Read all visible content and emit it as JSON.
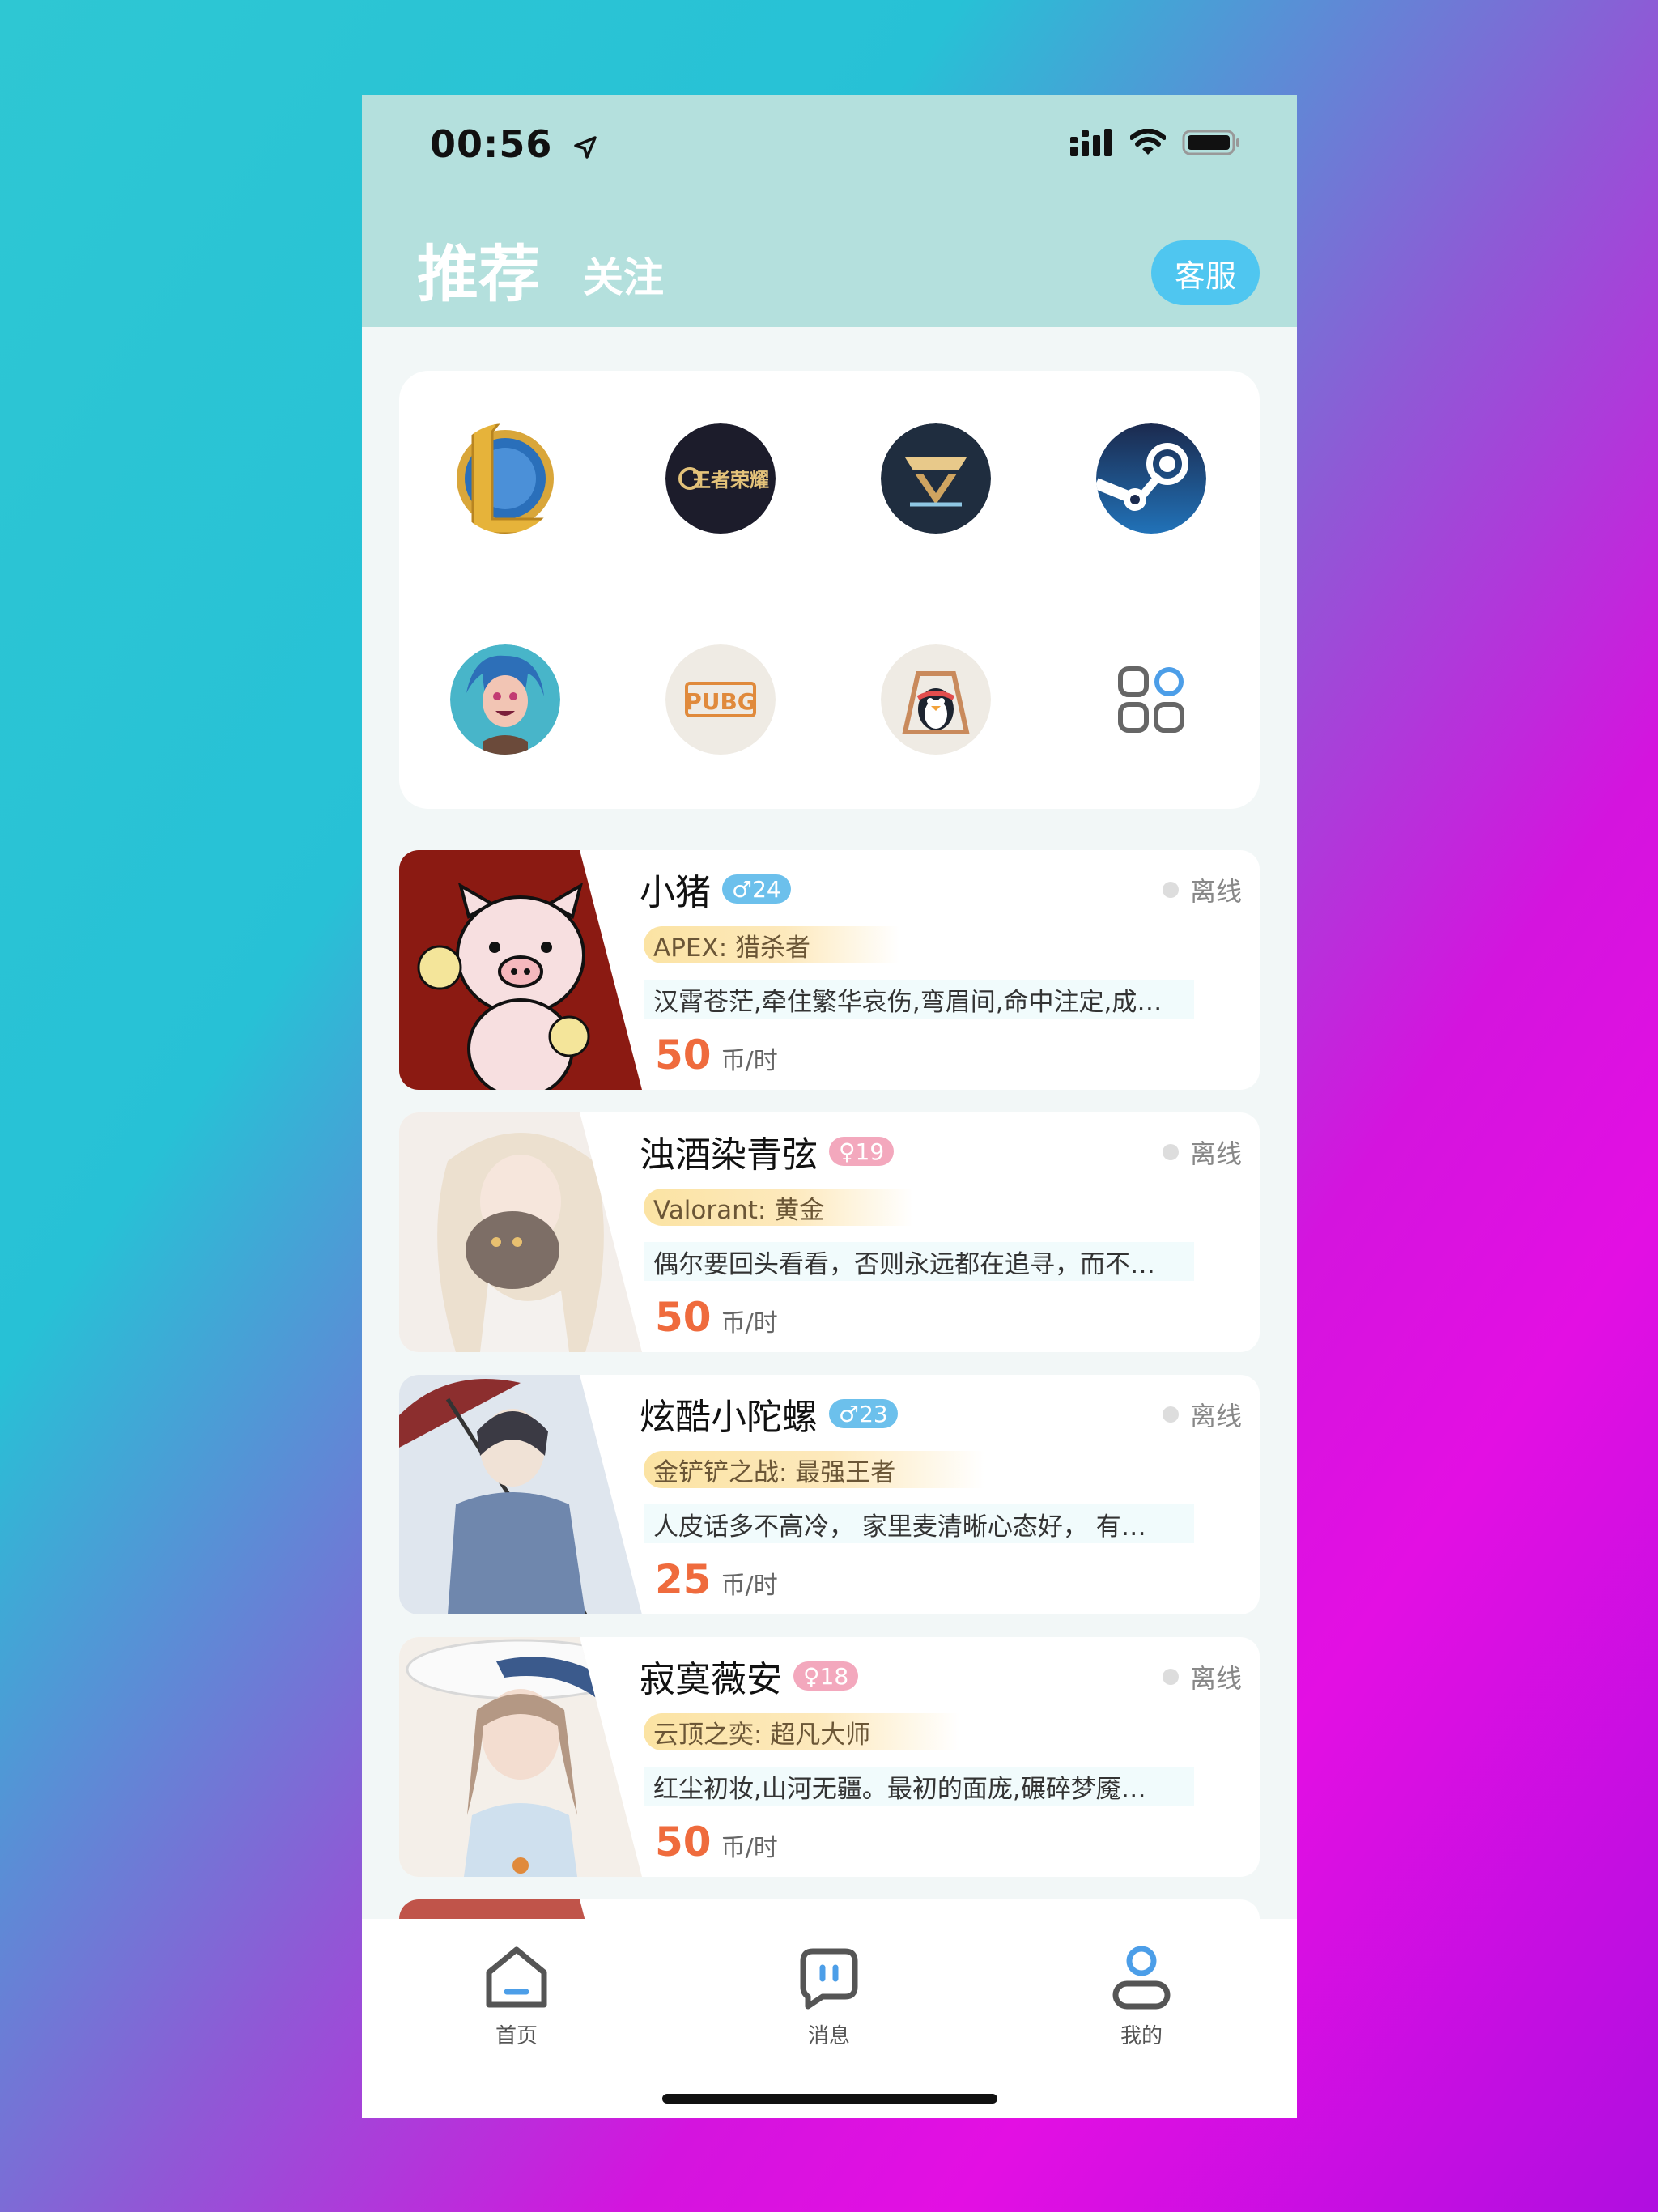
{
  "status_bar": {
    "time": "00:56"
  },
  "header": {
    "tab_recommend": "推荐",
    "tab_follow": "关注",
    "service_button": "客服"
  },
  "games": [
    {
      "name": "league-of-legends",
      "label": ""
    },
    {
      "name": "honor-of-kings",
      "label": "王者荣耀"
    },
    {
      "name": "valorant",
      "label": ""
    },
    {
      "name": "steam",
      "label": ""
    },
    {
      "name": "tft-jinx",
      "label": ""
    },
    {
      "name": "pubg",
      "label": "PUBG"
    },
    {
      "name": "qq-penguin",
      "label": ""
    },
    {
      "name": "more-apps",
      "label": ""
    }
  ],
  "players": [
    {
      "name": "小猪",
      "gender": "male",
      "age": "♂24",
      "status": "离线",
      "tag": "APEX:   猎杀者",
      "desc": "汉霄苍茫,牵住繁华哀伤,弯眉间,命中注定,成…",
      "price": "50",
      "unit": "币/时"
    },
    {
      "name": "浊酒染青弦",
      "gender": "female",
      "age": "♀19",
      "status": "离线",
      "tag": "Valorant:   黄金",
      "desc": "偶尔要回头看看，否则永远都在追寻，而不…",
      "price": "50",
      "unit": "币/时"
    },
    {
      "name": "炫酷小陀螺",
      "gender": "male",
      "age": "♂23",
      "status": "离线",
      "tag": "金铲铲之战:   最强王者",
      "desc": "人皮话多不高冷， 家里麦清晰心态好， 有…",
      "price": "25",
      "unit": "币/时"
    },
    {
      "name": "寂寞薇安",
      "gender": "female",
      "age": "♀18",
      "status": "离线",
      "tag": "云顶之奕:   超凡大师",
      "desc": "红尘初妆,山河无疆。最初的面庞,碾碎梦魇…",
      "price": "50",
      "unit": "币/时"
    }
  ],
  "tabbar": {
    "home": "首页",
    "messages": "消息",
    "mine": "我的"
  },
  "colors": {
    "header_bg": "#b4e0dd",
    "accent_blue": "#4fc6f0",
    "price_orange": "#ef6b3d"
  }
}
